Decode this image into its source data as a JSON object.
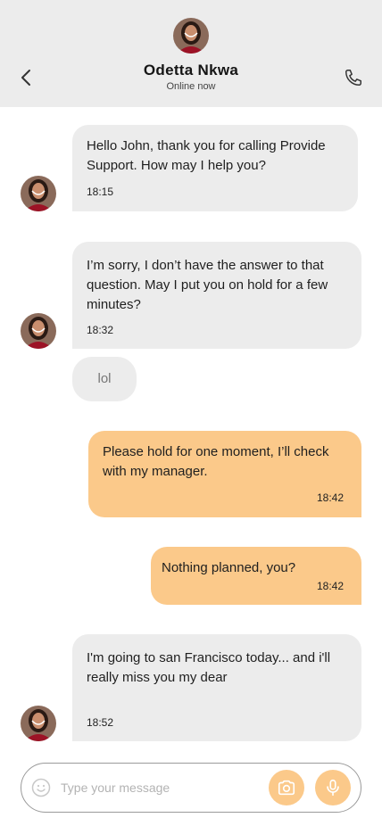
{
  "header": {
    "name": "Odetta Nkwa",
    "status": "Online now"
  },
  "messages": [
    {
      "direction": "in",
      "text": "Hello John, thank you for calling Provide Support. How may I help you?",
      "time": "18:15"
    },
    {
      "direction": "in",
      "text": "I’m sorry, I don’t have the answer to that question. May I put you on hold for a few minutes?",
      "time": "18:32"
    },
    {
      "direction": "in",
      "text": "lol",
      "time": ""
    },
    {
      "direction": "out",
      "text": "Please hold for one moment, I’ll check with my manager.",
      "time": "18:42"
    },
    {
      "direction": "out",
      "text": "Nothing planned, you?",
      "time": "18:42"
    },
    {
      "direction": "in",
      "text": "I'm going to san Francisco today... and i'll really miss you my dear",
      "time": "18:52"
    }
  ],
  "composer": {
    "placeholder": "Type your message"
  },
  "colors": {
    "header_bg": "#ececec",
    "incoming_bubble": "#ececec",
    "outgoing_bubble": "#fbc98a",
    "accent": "#fbc98a"
  },
  "icons": {
    "back": "chevron-left-icon",
    "call": "phone-icon",
    "emoji": "smiley-icon",
    "camera": "camera-icon",
    "mic": "microphone-icon"
  }
}
